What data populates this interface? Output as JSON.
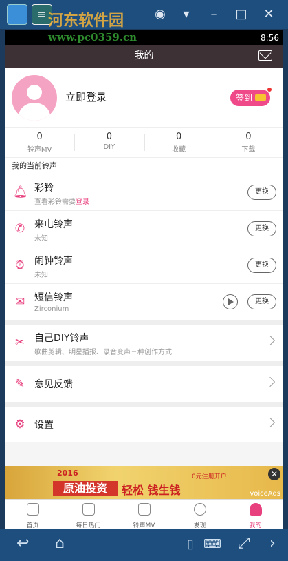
{
  "watermark": {
    "site": "河东软件园",
    "url": "www.pc0359.cn"
  },
  "status": {
    "time": "8:56"
  },
  "header": {
    "title": "我的"
  },
  "profile": {
    "login_label": "立即登录",
    "signin_label": "签到"
  },
  "stats": [
    {
      "value": "0",
      "label": "铃声MV"
    },
    {
      "value": "0",
      "label": "DIY"
    },
    {
      "value": "0",
      "label": "收藏"
    },
    {
      "value": "0",
      "label": "下载"
    }
  ],
  "section": {
    "title": "我的当前铃声"
  },
  "ringtones": [
    {
      "title": "彩铃",
      "sub_prefix": "查看彩铃需要",
      "sub_link": "登录",
      "action": "更换"
    },
    {
      "title": "来电铃声",
      "sub": "未知",
      "action": "更换"
    },
    {
      "title": "闹钟铃声",
      "sub": "未知",
      "action": "更换"
    },
    {
      "title": "短信铃声",
      "sub": "Zirconium",
      "action": "更换"
    }
  ],
  "menu": [
    {
      "title": "自己DIY铃声",
      "sub": "歌曲剪辑、明星播报、录音变声三种创作方式"
    },
    {
      "title": "意见反馈"
    },
    {
      "title": "设置"
    }
  ],
  "ad": {
    "year": "2016",
    "text1": "原油投资",
    "text2": "轻松  钱生钱",
    "text3": "0元注册开户",
    "brand": "voiceAds"
  },
  "tabs": [
    {
      "label": "首页"
    },
    {
      "label": "每日热门"
    },
    {
      "label": "铃声MV"
    },
    {
      "label": "发现"
    },
    {
      "label": "我的"
    }
  ],
  "colors": {
    "accent": "#e8407e",
    "header": "#3d3135"
  }
}
